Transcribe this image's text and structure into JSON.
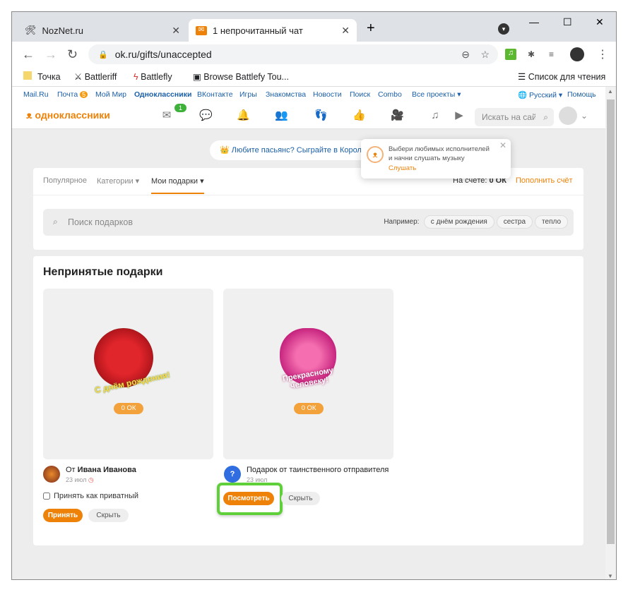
{
  "browser": {
    "tabs": [
      {
        "title": "NozNet.ru"
      },
      {
        "title": "1 непрочитанный чат"
      }
    ],
    "url": "ok.ru/gifts/unaccepted",
    "bookmarks": [
      "Точка",
      "Battleriff",
      "Battlefly",
      "Browse Battlefy Tou...",
      "Список для чтения"
    ]
  },
  "topnav": {
    "items": [
      "Mail.Ru",
      "Почта",
      "Мой Мир",
      "Одноклассники",
      "ВКонтакте",
      "Игры",
      "Знакомства",
      "Новости",
      "Поиск",
      "Combo",
      "Все проекты ▾"
    ],
    "mail_count": "5",
    "language": "Русский ▾",
    "help": "Помощь"
  },
  "ok": {
    "logo": "одноклассники",
    "messages_badge": "1",
    "search_placeholder": "Искать на сайте"
  },
  "promo": {
    "text": "Любите пасьянс? Сыграйте в Королевский пасьянс"
  },
  "popup": {
    "text": "Выбери любимых исполнителей и начни слушать музыку",
    "link": "Слушать"
  },
  "gifts_nav": {
    "tabs": [
      "Популярное",
      "Категории ▾",
      "Мои подарки ▾"
    ],
    "balance_label": "На счёте:",
    "balance_value": "0 ОК",
    "topup": "Пополнить счёт",
    "search_placeholder": "Поиск подарков",
    "example_label": "Например:",
    "chips": [
      "с днём рождения",
      "сестра",
      "тепло"
    ]
  },
  "unaccepted": {
    "title": "Непринятые подарки",
    "gifts": [
      {
        "price": "0 ОК",
        "from_prefix": "От ",
        "from_name": "Ивана Иванова",
        "date": "23 июл",
        "private_label": "Принять как приватный",
        "accept": "Принять",
        "hide": "Скрыть",
        "image_text": "С днём рождения!"
      },
      {
        "price": "0 ОК",
        "from": "Подарок от таинственного отправителя",
        "date": "23 июл",
        "view": "Посмотреть",
        "hide": "Скрыть",
        "image_text": "Прекрасному человеку!"
      }
    ]
  },
  "colors": {
    "ok_orange": "#ee8208",
    "link_blue": "#1a5fa8",
    "highlight_green": "#5fd03a"
  }
}
